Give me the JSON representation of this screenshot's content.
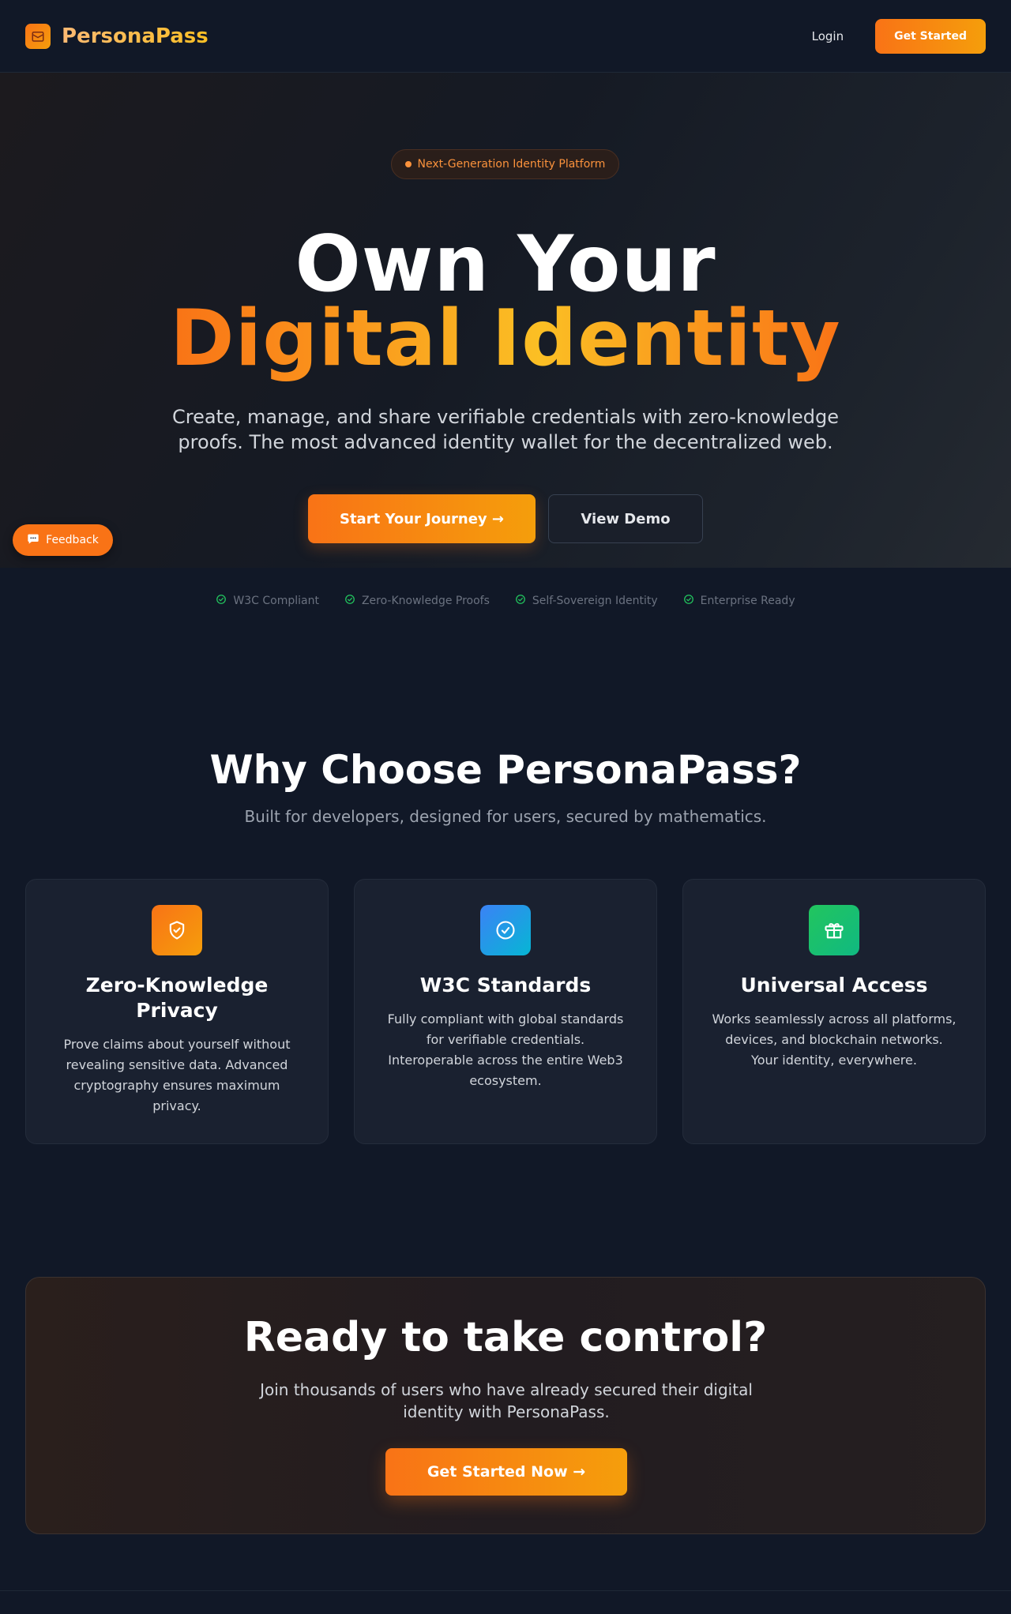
{
  "nav": {
    "brand": "PersonaPass",
    "brand_icon": "wallet-icon",
    "login_label": "Login",
    "get_started_label": "Get Started"
  },
  "hero": {
    "badge": "Next-Generation Identity Platform",
    "title_line1": "Own Your",
    "title_line2": "Digital Identity",
    "subtitle": "Create, manage, and share verifiable credentials with zero-knowledge proofs. The most advanced identity wallet for the decentralized web.",
    "primary_cta": "Start Your Journey →",
    "secondary_cta": "View Demo"
  },
  "feedback": {
    "label": "Feedback",
    "icon": "speech-bubble-icon"
  },
  "trust_items": [
    "W3C Compliant",
    "Zero-Knowledge Proofs",
    "Self-Sovereign Identity",
    "Enterprise Ready"
  ],
  "features": {
    "title": "Why Choose PersonaPass?",
    "subtitle": "Built for developers, designed for users, secured by mathematics.",
    "cards": [
      {
        "icon": "shield-check-icon",
        "title": "Zero-Knowledge Privacy",
        "description": "Prove claims about yourself without revealing sensitive data. Advanced cryptography ensures maximum privacy."
      },
      {
        "icon": "check-circle-icon",
        "title": "W3C Standards",
        "description": "Fully compliant with global standards for verifiable credentials. Interoperable across the entire Web3 ecosystem."
      },
      {
        "icon": "gift-icon",
        "title": "Universal Access",
        "description": "Works seamlessly across all platforms, devices, and blockchain networks. Your identity, everywhere."
      }
    ]
  },
  "cta": {
    "title": "Ready to take control?",
    "subtitle": "Join thousands of users who have already secured their digital identity with PersonaPass.",
    "button": "Get Started Now →"
  },
  "colors": {
    "background": "#111827",
    "accent": "#f97316",
    "accent_end": "#f59e0b",
    "card": "#1a2130",
    "success": "#22c55e"
  }
}
